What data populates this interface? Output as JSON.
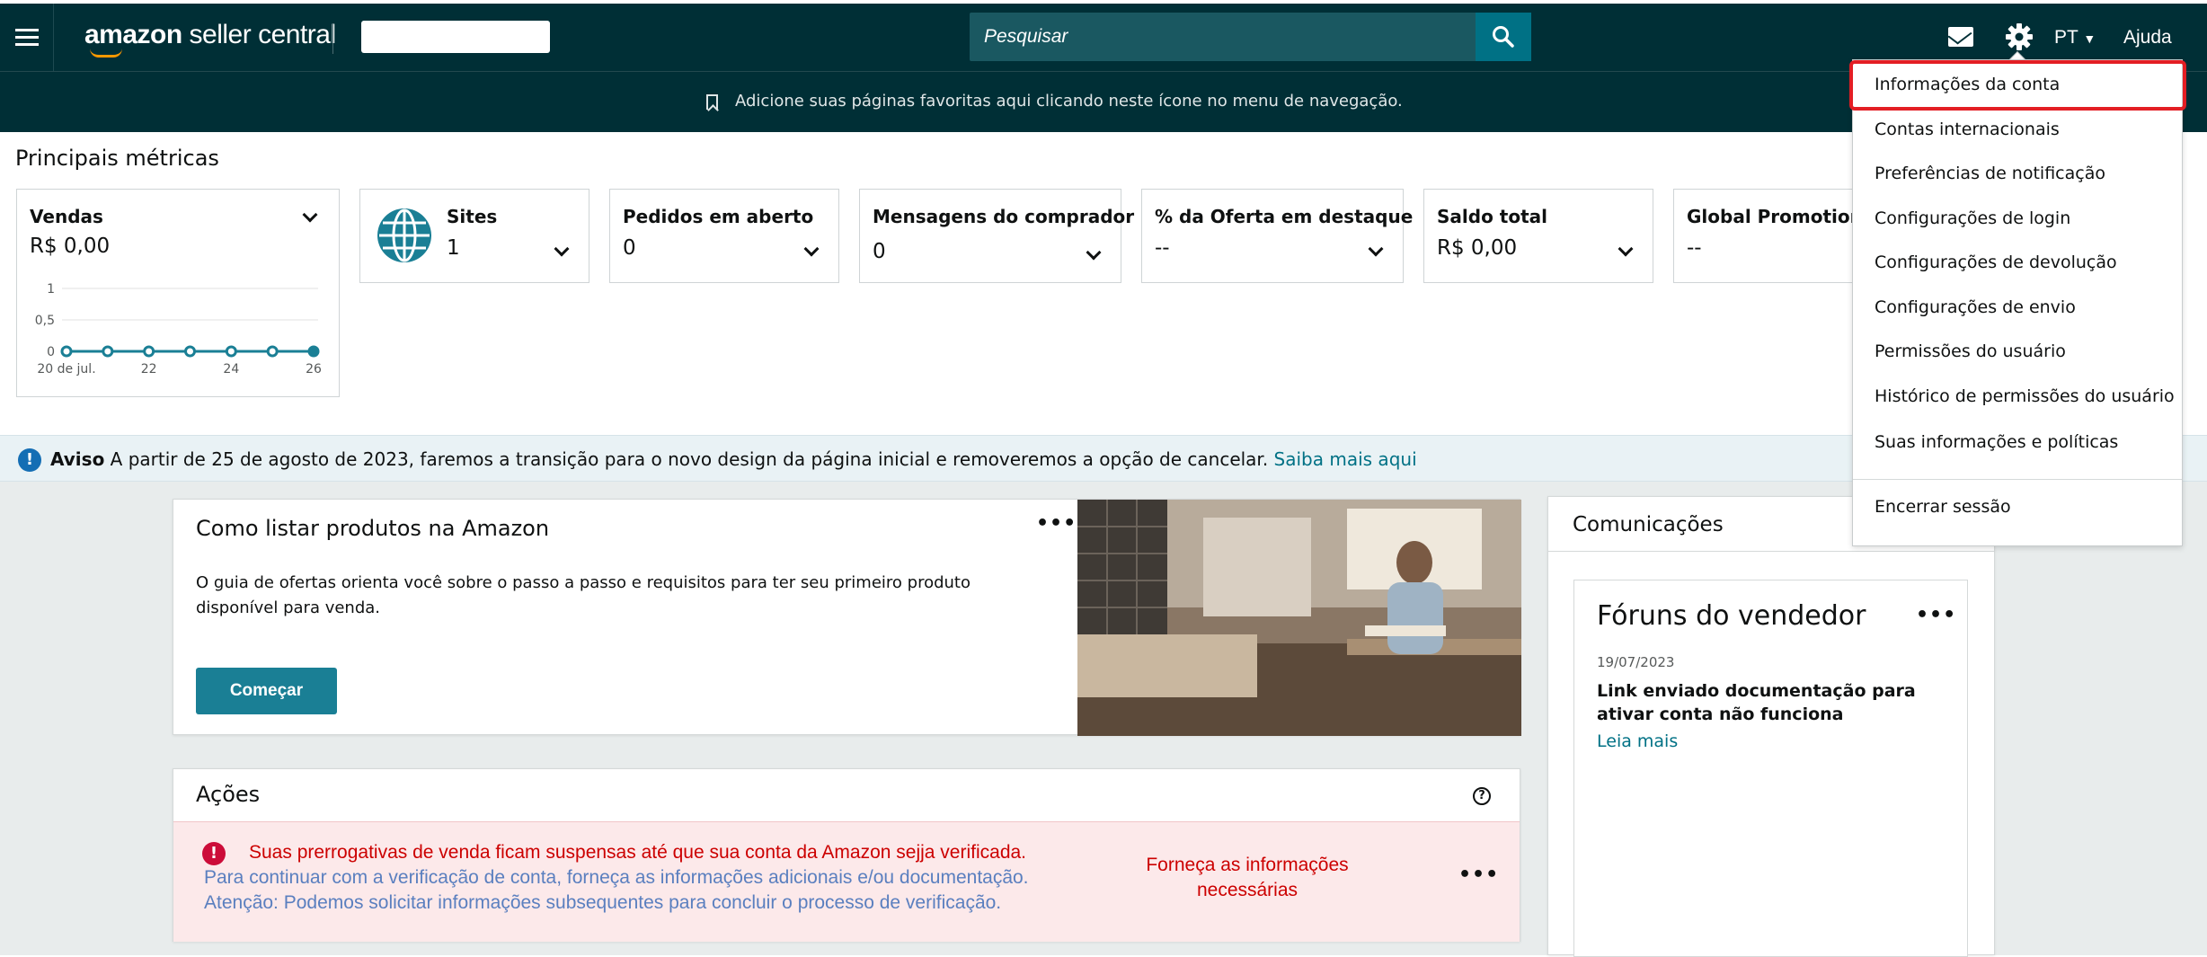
{
  "nav": {
    "logo_brand": "amazon",
    "logo_product": "seller central",
    "search_placeholder": "Pesquisar",
    "language": "PT",
    "help": "Ajuda",
    "brand_color": "#002f36",
    "accent_color": "#007185"
  },
  "favorites_bar": {
    "text": "Adicione suas páginas favoritas aqui clicando neste ícone no menu de navegação."
  },
  "metrics": {
    "title": "Principais métricas",
    "vendas": {
      "label": "Vendas",
      "value": "R$ 0,00",
      "y_ticks": [
        "1",
        "0,5",
        "0"
      ],
      "x_ticks": [
        "20 de jul.",
        "22",
        "24",
        "26"
      ]
    },
    "cards": [
      {
        "label": "Sites",
        "value": "1"
      },
      {
        "label": "Pedidos em aberto",
        "value": "0"
      },
      {
        "label": "Mensagens do comprador",
        "value": "0"
      },
      {
        "label": "% da Oferta em destaque",
        "value": "--"
      },
      {
        "label": "Saldo total",
        "value": "R$ 0,00"
      },
      {
        "label": "Global Promotion",
        "value": "--"
      }
    ]
  },
  "chart_data": {
    "type": "line",
    "title": "Vendas",
    "x": [
      "20 de jul.",
      "21",
      "22",
      "23",
      "24",
      "25",
      "26"
    ],
    "values": [
      0,
      0,
      0,
      0,
      0,
      0,
      0
    ],
    "ylim": [
      0,
      1
    ],
    "x_tick_labels": [
      "20 de jul.",
      "22",
      "24",
      "26"
    ],
    "y_tick_labels": [
      "0",
      "0,5",
      "1"
    ],
    "grid": true
  },
  "dropdown": {
    "items": [
      "Informações da conta",
      "Contas internacionais",
      "Preferências de notificação",
      "Configurações de login",
      "Configurações de devolução",
      "Configurações de envio",
      "Permissões do usuário",
      "Histórico de permissões do usuário",
      "Suas informações e políticas"
    ],
    "logout": "Encerrar sessão",
    "highlight_color": "#e31e24"
  },
  "notice": {
    "label": "Aviso",
    "text": "A partir de 25 de agosto de 2023, faremos a transição para o novo design da página inicial e removeremos a opção de cancelar.",
    "link": "Saiba mais aqui"
  },
  "listar": {
    "title": "Como listar produtos na Amazon",
    "description": "O guia de ofertas orienta você sobre o passo a passo e requisitos para ter seu primeiro produto disponível para venda.",
    "button": "Começar",
    "more": "•••"
  },
  "acoes": {
    "title": "Ações",
    "help": "?",
    "alert_title": "Suas prerrogativas de venda ficam suspensas até que sua conta da Amazon sejja verificada.",
    "alert_line2": "Para continuar com a verificação de conta, forneça as informações adicionais e/ou documentação.",
    "alert_line3": "Atenção: Podemos solicitar informações subsequentes para concluir o processo de verificação.",
    "cta": "Forneça as informações necessárias",
    "more": "•••",
    "alert_color": "#cc0000"
  },
  "comunicacoes": {
    "title": "Comunicações",
    "forum_title": "Fóruns do vendedor",
    "forum_more": "•••",
    "post_date": "19/07/2023",
    "post_title": "Link enviado documentação para ativar conta não funciona",
    "read_more": "Leia mais"
  }
}
